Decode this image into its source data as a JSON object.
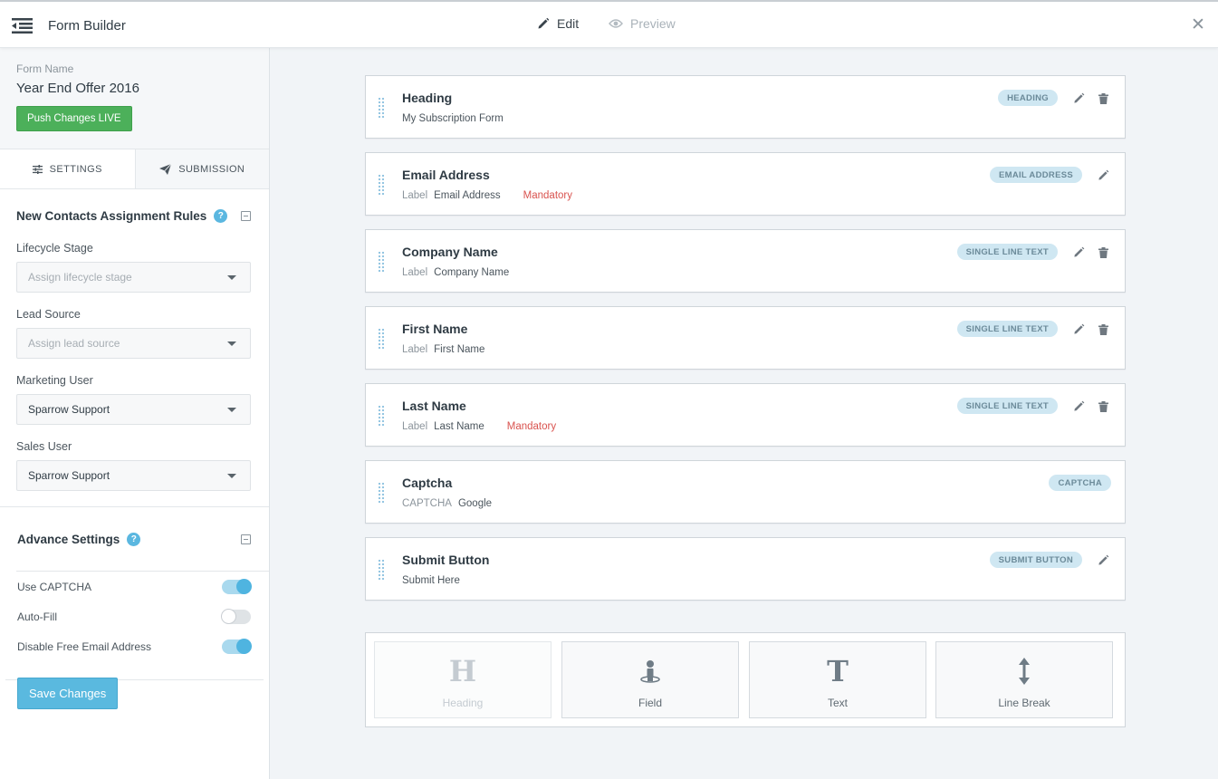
{
  "header": {
    "title": "Form Builder",
    "edit_label": "Edit",
    "preview_label": "Preview",
    "close_glyph": "✕"
  },
  "sidebar": {
    "form_name_label": "Form Name",
    "form_name_value": "Year End Offer 2016",
    "push_label": "Push Changes LIVE",
    "tabs": [
      {
        "label": "SETTINGS",
        "icon": "sliders-icon",
        "active": true
      },
      {
        "label": "SUBMISSION",
        "icon": "paper-plane-icon",
        "active": false
      }
    ],
    "assignment": {
      "title": "New Contacts Assignment Rules",
      "help": "?",
      "fields": [
        {
          "label": "Lifecycle Stage",
          "value": "Assign lifecycle stage",
          "placeholder": true
        },
        {
          "label": "Lead Source",
          "value": "Assign lead source",
          "placeholder": true
        },
        {
          "label": "Marketing User",
          "value": "Sparrow Support",
          "placeholder": false
        },
        {
          "label": "Sales User",
          "value": "Sparrow Support",
          "placeholder": false
        }
      ]
    },
    "advanced": {
      "title": "Advance Settings",
      "help": "?",
      "toggles": [
        {
          "label": "Use CAPTCHA",
          "on": true
        },
        {
          "label": "Auto-Fill",
          "on": false
        },
        {
          "label": "Disable Free Email Address",
          "on": true
        }
      ]
    },
    "save_label": "Save Changes"
  },
  "fields": [
    {
      "title": "Heading",
      "sub_key": "",
      "sub_value": "My Subscription Form",
      "mandatory": "",
      "badge": "HEADING",
      "actions": [
        "edit-icon",
        "delete-icon"
      ]
    },
    {
      "title": "Email Address",
      "sub_key": "Label",
      "sub_value": "Email Address",
      "mandatory": "Mandatory",
      "badge": "EMAIL ADDRESS",
      "actions": [
        "edit-icon"
      ]
    },
    {
      "title": "Company Name",
      "sub_key": "Label",
      "sub_value": "Company Name",
      "mandatory": "",
      "badge": "SINGLE LINE TEXT",
      "actions": [
        "edit-icon",
        "delete-icon"
      ]
    },
    {
      "title": "First Name",
      "sub_key": "Label",
      "sub_value": "First Name",
      "mandatory": "",
      "badge": "SINGLE LINE TEXT",
      "actions": [
        "edit-icon",
        "delete-icon"
      ]
    },
    {
      "title": "Last Name",
      "sub_key": "Label",
      "sub_value": "Last Name",
      "mandatory": "Mandatory",
      "badge": "SINGLE LINE TEXT",
      "actions": [
        "edit-icon",
        "delete-icon"
      ]
    },
    {
      "title": "Captcha",
      "sub_key": "CAPTCHA",
      "sub_value": "Google",
      "mandatory": "",
      "badge": "CAPTCHA",
      "actions": []
    },
    {
      "title": "Submit Button",
      "sub_key": "",
      "sub_value": "Submit Here",
      "mandatory": "",
      "badge": "SUBMIT BUTTON",
      "actions": [
        "edit-icon"
      ]
    }
  ],
  "palette": [
    {
      "label": "Heading",
      "icon": "heading-icon",
      "glyph": "H",
      "enabled": false
    },
    {
      "label": "Field",
      "icon": "person-icon",
      "glyph": "",
      "enabled": true
    },
    {
      "label": "Text",
      "icon": "text-icon",
      "glyph": "T",
      "enabled": true
    },
    {
      "label": "Line Break",
      "icon": "vertical-arrows-icon",
      "glyph": "",
      "enabled": true
    }
  ]
}
